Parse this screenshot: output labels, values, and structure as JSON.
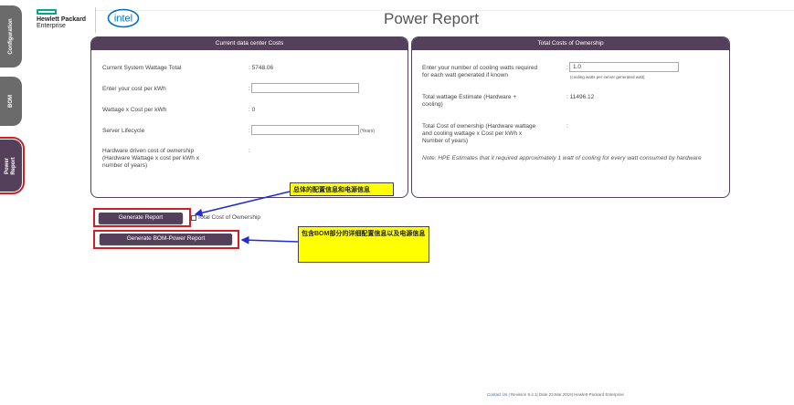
{
  "sidebar": {
    "tabs": [
      {
        "label": "Configuration"
      },
      {
        "label": "BOM"
      },
      {
        "label_line1": "Power",
        "label_line2": "Report"
      }
    ]
  },
  "header": {
    "brand_line1": "Hewlett Packard",
    "brand_line2": "Enterprise",
    "partner_logo": "intel",
    "title": "Power Report"
  },
  "costs_panel": {
    "title": "Current data center Costs",
    "rows": [
      {
        "label": "Current System Wattage Total",
        "value": ": 5748.06"
      },
      {
        "label": "Enter your cost per kWh",
        "value": ":"
      },
      {
        "label": "Wattage x Cost per kWh",
        "value": ": 0"
      },
      {
        "label": "Server Lifecycle",
        "value": ":",
        "suffix": "(Years)"
      },
      {
        "label_line1": "Hardware driven cost of ownership",
        "label_line2": "(Hardware Wattage x cost per kWh x",
        "label_line3": "number of years)",
        "value": ":"
      }
    ]
  },
  "tco_panel": {
    "title": "Total Costs of Ownership",
    "rows": [
      {
        "label_line1": "Enter your number of cooling watts required",
        "label_line2": "for each watt generated if known",
        "value": ":",
        "input_value": "1.0",
        "hint": "(cooling watts per server generated watt)"
      },
      {
        "label_line1": "Total wattage Estimate (Hardware +",
        "label_line2": "cooling)",
        "value": ": 11496.12"
      },
      {
        "label_line1": "Total Cost of ownership (Hardware wattage",
        "label_line2": "and cooling wattage x Cost per kWh x",
        "label_line3": "Number of years)",
        "value": ":"
      }
    ],
    "note": "Note: HPE Estimates that it required approximately 1 watt of cooling for every watt consumed by hardware"
  },
  "actions": {
    "generate_report": "Generate Report",
    "tco_checkbox_label": "Total Cost of Ownership",
    "generate_bom_report": "Generate BOM-Power Report"
  },
  "annotations": {
    "callout1": "总体的配置信息和电源信息",
    "callout2": "包含BOM部分的详细配置信息以及电源信息"
  },
  "footer": {
    "contact": "Contact Us",
    "revision": " | Revision 9.4.1| Date 23.Mar.2019| Hewlett-Packard Enterprise"
  },
  "colors": {
    "accent": "#55405b",
    "highlight": "#d21f26",
    "callout": "#ffff00",
    "hpe_green": "#01a982",
    "intel_blue": "#0071c5"
  }
}
